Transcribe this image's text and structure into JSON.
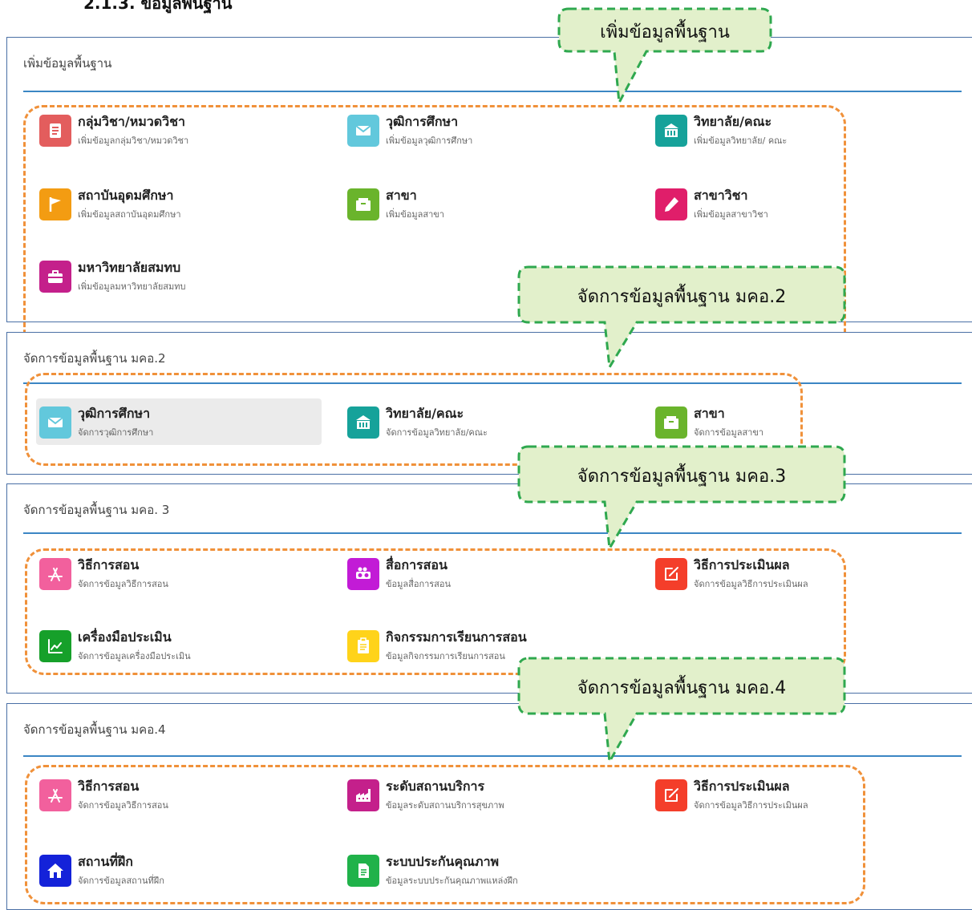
{
  "heading": "2.1.3. ข้อมูลพื้นฐาน",
  "colors": {
    "accent_rule": "#3b86c4",
    "panel_border": "#4a6fa5",
    "outline_orange": "#f0913a",
    "callout_fill": "#e2f0cb",
    "callout_border": "#2fa84f"
  },
  "panels": [
    {
      "title": "เพิ่มข้อมูลพื้นฐาน",
      "items": [
        {
          "label": "กลุ่มวิชา/หมวดวิชา",
          "sub": "เพิ่มข้อมูลกลุ่มวิชา/หมวดวิชา",
          "icon": "notebook-icon",
          "color": "#e35d5d"
        },
        {
          "label": "วุฒิการศึกษา",
          "sub": "เพิ่มข้อมูลวุฒิการศึกษา",
          "icon": "envelope-icon",
          "color": "#62c8dc"
        },
        {
          "label": "วิทยาลัย/คณะ",
          "sub": "เพิ่มข้อมูลวิทยาลัย/ คณะ",
          "icon": "building-icon",
          "color": "#16a29a"
        },
        {
          "label": "สถาบันอุดมศึกษา",
          "sub": "เพิ่มข้อมูลสถาบันอุดมศึกษา",
          "icon": "flag-icon",
          "color": "#f39c12"
        },
        {
          "label": "สาขา",
          "sub": "เพิ่มข้อมูลสาขา",
          "icon": "inbox-icon",
          "color": "#6ab42c"
        },
        {
          "label": "สาขาวิชา",
          "sub": "เพิ่มข้อมูลสาขาวิชา",
          "icon": "pencil-icon",
          "color": "#e01e6a"
        },
        {
          "label": "มหาวิทยาลัยสมทบ",
          "sub": "เพิ่มข้อมูลมหาวิทยาลัยสมทบ",
          "icon": "briefcase-icon",
          "color": "#c4208b"
        }
      ]
    },
    {
      "title": "จัดการข้อมูลพื้นฐาน มคอ.2",
      "items": [
        {
          "label": "วุฒิการศึกษา",
          "sub": "จัดการวุฒิการศึกษา",
          "icon": "envelope-icon",
          "color": "#62c8dc",
          "active": true
        },
        {
          "label": "วิทยาลัย/คณะ",
          "sub": "จัดการข้อมูลวิทยาลัย/คณะ",
          "icon": "building-icon",
          "color": "#16a29a"
        },
        {
          "label": "สาขา",
          "sub": "จัดการข้อมูลสาขา",
          "icon": "inbox-icon",
          "color": "#6ab42c"
        }
      ]
    },
    {
      "title": "จัดการข้อมูลพื้นฐาน มคอ. 3",
      "items": [
        {
          "label": "วิธีการสอน",
          "sub": "จัดการข้อมูลวิธีการสอน",
          "icon": "app-store-icon",
          "color": "#f2609d"
        },
        {
          "label": "สื่อการสอน",
          "sub": "ข้อมูลสื่อการสอน",
          "icon": "projector-icon",
          "color": "#c21bd6"
        },
        {
          "label": "วิธีการประเมินผล",
          "sub": "จัดการข้อมูลวิธีการประเมินผล",
          "icon": "edit-icon",
          "color": "#f43e2a"
        },
        {
          "label": "เครื่องมือประเมิน",
          "sub": "จัดการข้อมูลเครื่องมือประเมิน",
          "icon": "chart-icon",
          "color": "#16a02a"
        },
        {
          "label": "กิจกรรมการเรียนการสอน",
          "sub": "ข้อมูลกิจกรรมการเรียนการสอน",
          "icon": "clipboard-icon",
          "color": "#ffd31a"
        }
      ]
    },
    {
      "title": "จัดการข้อมูลพื้นฐาน มคอ.4",
      "items": [
        {
          "label": "วิธีการสอน",
          "sub": "จัดการข้อมูลวิธีการสอน",
          "icon": "app-store-icon",
          "color": "#f2609d"
        },
        {
          "label": "ระดับสถานบริการ",
          "sub": "ข้อมูลระดับสถานบริการสุขภาพ",
          "icon": "factory-icon",
          "color": "#c4208b"
        },
        {
          "label": "วิธีการประเมินผล",
          "sub": "จัดการข้อมูลวิธีการประเมินผล",
          "icon": "edit-icon",
          "color": "#f43e2a"
        },
        {
          "label": "สถานที่ฝึก",
          "sub": "จัดการข้อมูลสถานที่ฝึก",
          "icon": "home-icon",
          "color": "#1422d9"
        },
        {
          "label": "ระบบประกันคุณภาพ",
          "sub": "ข้อมูลระบบประกันคุณภาพแหล่งฝึก",
          "icon": "document-icon",
          "color": "#20b24a"
        }
      ]
    }
  ],
  "callouts": [
    "เพิ่มข้อมูลพื้นฐาน",
    "จัดการข้อมูลพื้นฐาน มคอ.2",
    "จัดการข้อมูลพื้นฐาน มคอ.3",
    "จัดการข้อมูลพื้นฐาน มคอ.4"
  ]
}
